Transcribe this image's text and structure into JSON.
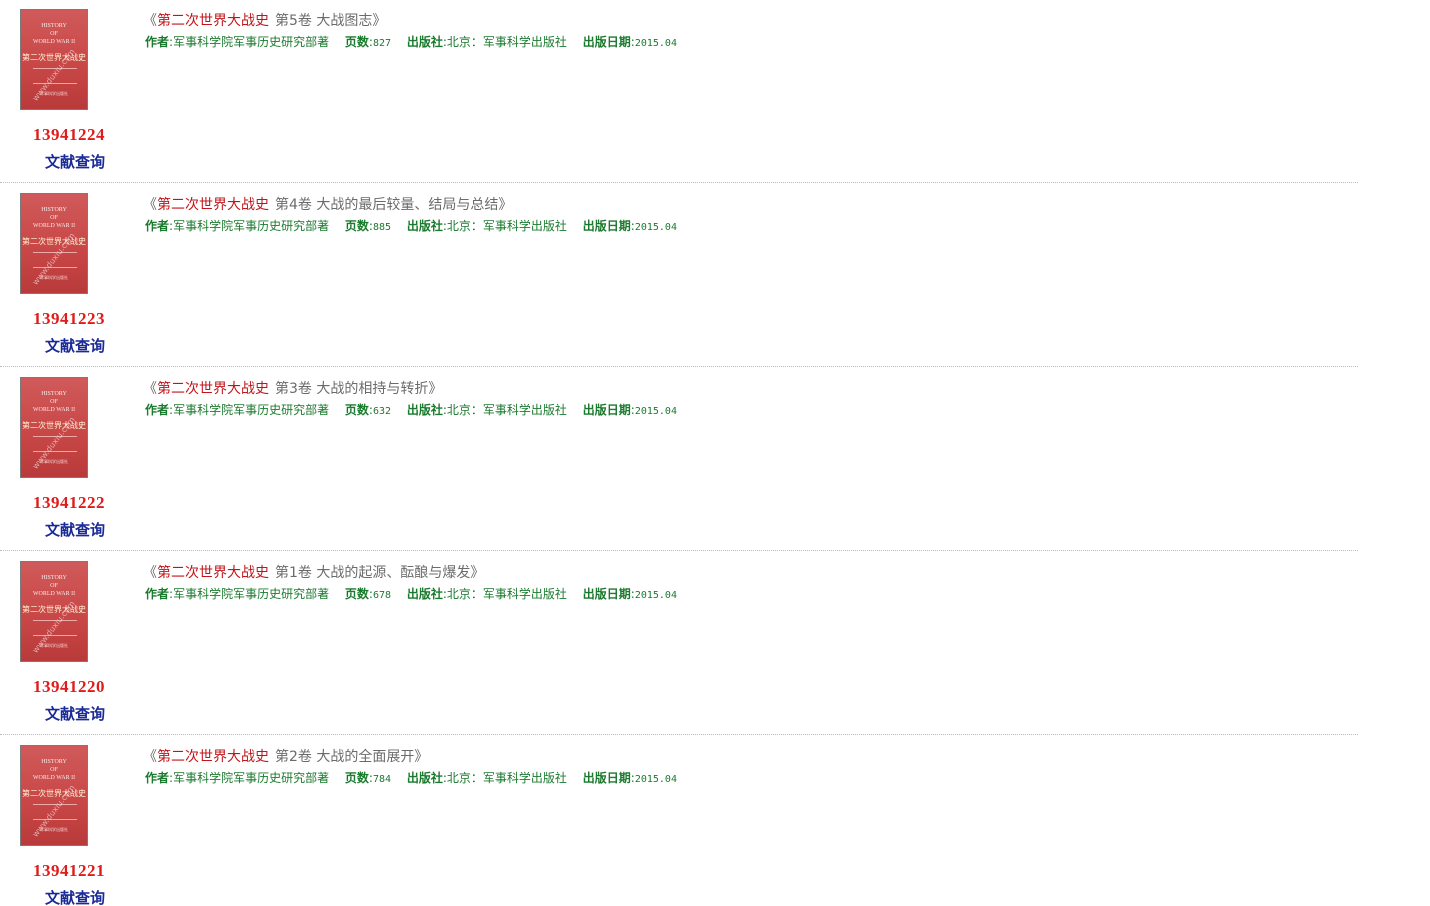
{
  "labels": {
    "author": "作者",
    "pages": "页数",
    "publisher": "出版社",
    "date": "出版日期",
    "query": "文献查询",
    "quote_open": "《",
    "quote_close": "》",
    "colon": ":"
  },
  "cover": {
    "title_en": "HISTORY\nOF\nWORLD WAR II",
    "title_cn": "第二次世界大战史",
    "watermark": "www.duxiu.com",
    "publisher_small": "军事科学出版社"
  },
  "books": [
    {
      "series": "第二次世界大战史",
      "volume": "第5卷  大战图志",
      "author": "军事科学院军事历史研究部著",
      "pages": "827",
      "publisher": "北京：军事科学出版社",
      "date": "2015.04",
      "ssid": "13941224"
    },
    {
      "series": "第二次世界大战史",
      "volume": "第4卷  大战的最后较量、结局与总结",
      "author": "军事科学院军事历史研究部著",
      "pages": "885",
      "publisher": "北京：军事科学出版社",
      "date": "2015.04",
      "ssid": "13941223"
    },
    {
      "series": "第二次世界大战史",
      "volume": "第3卷  大战的相持与转折",
      "author": "军事科学院军事历史研究部著",
      "pages": "632",
      "publisher": "北京：军事科学出版社",
      "date": "2015.04",
      "ssid": "13941222"
    },
    {
      "series": "第二次世界大战史",
      "volume": "第1卷  大战的起源、酝酿与爆发",
      "author": "军事科学院军事历史研究部著",
      "pages": "678",
      "publisher": "北京：军事科学出版社",
      "date": "2015.04",
      "ssid": "13941220"
    },
    {
      "series": "第二次世界大战史",
      "volume": "第2卷  大战的全面展开",
      "author": "军事科学院军事历史研究部著",
      "pages": "784",
      "publisher": "北京：军事科学出版社",
      "date": "2015.04",
      "ssid": "13941221"
    }
  ]
}
